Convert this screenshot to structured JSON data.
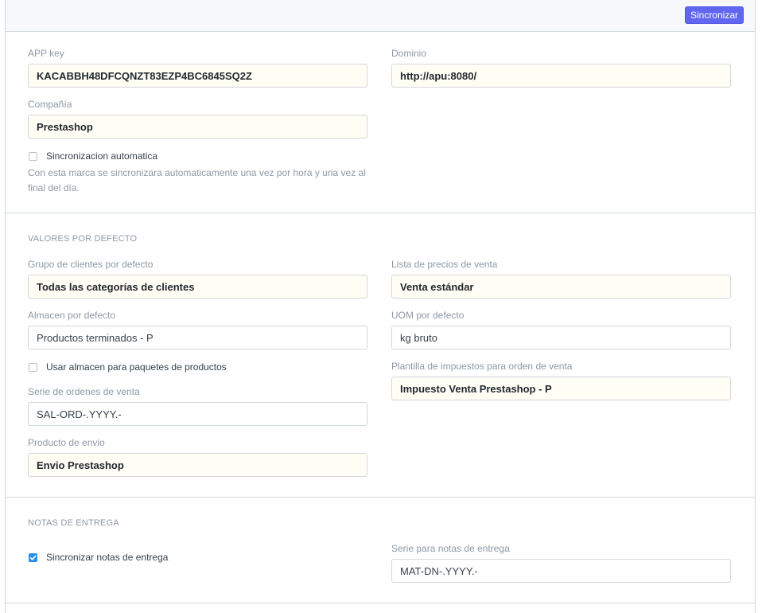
{
  "toolbar": {
    "sync_label": "Sincronizar"
  },
  "connection": {
    "app_key_label": "APP key",
    "app_key_value": "KACABBH48DFCQNZT83EZP4BC6845SQ2Z",
    "domain_label": "Dominio",
    "domain_value": "http://apu:8080/",
    "company_label": "Compañía",
    "company_value": "Prestashop",
    "auto_sync_label": "Sincronizacion automatica",
    "auto_sync_checked": false,
    "auto_sync_help": "Con esta marca se sincronizara automaticamente una vez por hora y una vez al final del día."
  },
  "defaults": {
    "heading": "VALORES POR DEFECTO",
    "customer_group_label": "Grupo de clientes por defecto",
    "customer_group_value": "Todas las categorías de clientes",
    "price_list_label": "Lista de precios de venta",
    "price_list_value": "Venta estándar",
    "warehouse_label": "Almacen por defecto",
    "warehouse_value": "Productos terminados - P",
    "uom_label": "UOM por defecto",
    "uom_value": "kg bruto",
    "use_warehouse_label": "Usar almacen para paquetes de productos",
    "use_warehouse_checked": false,
    "tax_template_label": "Plantilla de impuestos para orden de venta",
    "tax_template_value": "Impuesto Venta Prestashop - P",
    "sales_series_label": "Serie de ordenes de venta",
    "sales_series_value": "SAL-ORD-.YYYY.-",
    "shipping_product_label": "Producto de envio",
    "shipping_product_value": "Envio Prestashop"
  },
  "delivery": {
    "heading": "NOTAS DE ENTREGA",
    "sync_notes_label": "Sincronizar notas de entrega",
    "sync_notes_checked": true,
    "series_label": "Serie para notas de entrega",
    "series_value": "MAT-DN-.YYYY.-"
  },
  "colors": {
    "accent": "#6166f0",
    "checkbox_checked": "#2490ef",
    "field_bg": "#fffdf4",
    "border": "#d1d8dd"
  }
}
